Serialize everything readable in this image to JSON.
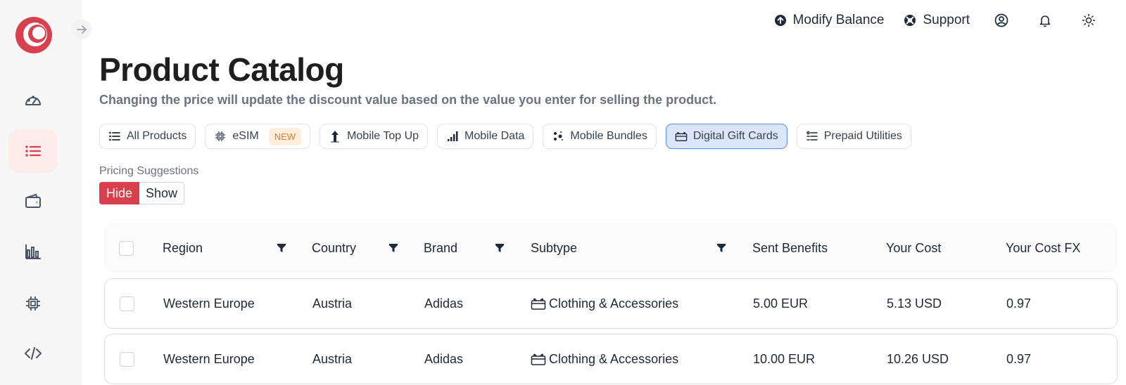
{
  "topbar": {
    "modify_balance": "Modify Balance",
    "support": "Support"
  },
  "sidebar": {
    "items": [
      {
        "name": "dashboard-icon"
      },
      {
        "name": "list-icon",
        "active": true
      },
      {
        "name": "wallet-icon"
      },
      {
        "name": "bar-chart-icon"
      },
      {
        "name": "chip-icon"
      },
      {
        "name": "code-icon"
      }
    ]
  },
  "page": {
    "title": "Product Catalog",
    "subtitle": "Changing the price will update the discount value based on the value you enter for selling the product."
  },
  "tabs": [
    {
      "label": "All Products",
      "icon": "list-icon"
    },
    {
      "label": "eSIM",
      "icon": "chip-icon",
      "badge": "NEW"
    },
    {
      "label": "Mobile Top Up",
      "icon": "top-up-icon"
    },
    {
      "label": "Mobile Data",
      "icon": "signal-icon"
    },
    {
      "label": "Mobile Bundles",
      "icon": "bundle-icon"
    },
    {
      "label": "Digital Gift Cards",
      "icon": "gift-card-icon",
      "active": true
    },
    {
      "label": "Prepaid Utilities",
      "icon": "utilities-icon"
    }
  ],
  "pricing": {
    "label": "Pricing Suggestions",
    "hide": "Hide",
    "show": "Show",
    "selected": "Hide"
  },
  "table": {
    "columns": [
      "Region",
      "Country",
      "Brand",
      "Subtype",
      "Sent Benefits",
      "Your Cost",
      "Your Cost FX"
    ],
    "rows": [
      {
        "region": "Western Europe",
        "country": "Austria",
        "brand": "Adidas",
        "subtype": "Clothing & Accessories",
        "sent_benefits": "5.00 EUR",
        "your_cost": "5.13 USD",
        "your_cost_fx": "0.97"
      },
      {
        "region": "Western Europe",
        "country": "Austria",
        "brand": "Adidas",
        "subtype": "Clothing & Accessories",
        "sent_benefits": "10.00 EUR",
        "your_cost": "10.26 USD",
        "your_cost_fx": "0.97"
      }
    ]
  },
  "colors": {
    "brand": "#d9404e",
    "active_tab_bg": "#dbe6fb",
    "active_tab_border": "#5b8ae8",
    "badge_text": "#e07a2e"
  }
}
